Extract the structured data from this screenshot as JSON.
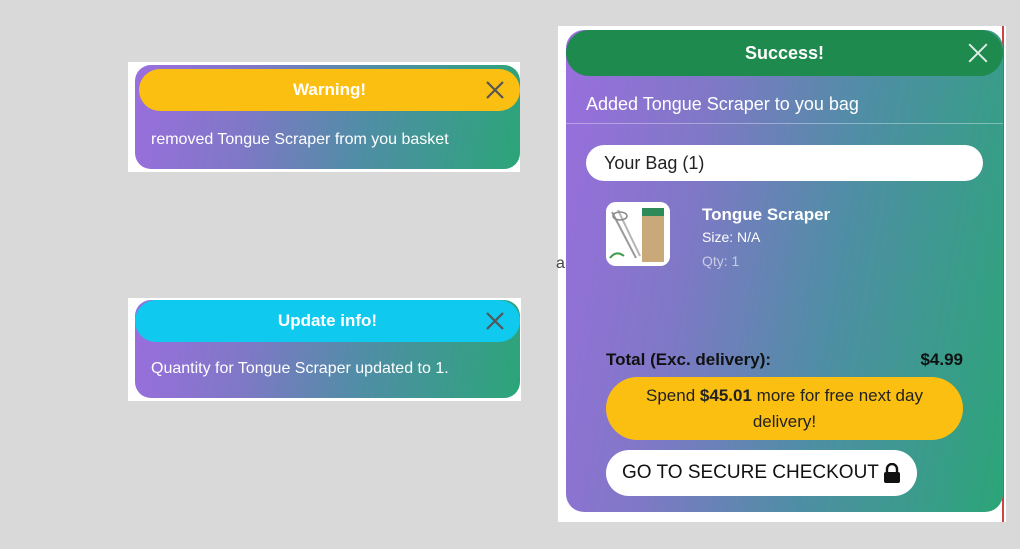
{
  "warning": {
    "title": "Warning!",
    "message": "removed Tongue Scraper from you basket",
    "color": "#fbbf12"
  },
  "info": {
    "title": "Update info!",
    "message": "Quantity for Tongue Scraper updated to 1.",
    "color": "#0fc9ee"
  },
  "success": {
    "title": "Success!",
    "message": "Added Tongue Scraper to you bag",
    "color": "#1e8a4e",
    "bag_label": "Your Bag (1)",
    "product": {
      "name": "Tongue Scraper",
      "size": "Size: N/A",
      "qty": "Qty: 1"
    },
    "total_label": "Total (Exc. delivery):",
    "total_value": "$4.99",
    "spend_prefix": "Spend",
    "spend_amount": "$45.01",
    "spend_suffix": "more for free next day delivery!",
    "spend_color": "#fbbf12",
    "checkout_label": "GO TO SECURE CHECKOUT",
    "checkout_icon": "lock-icon"
  },
  "stray_text": "ai"
}
